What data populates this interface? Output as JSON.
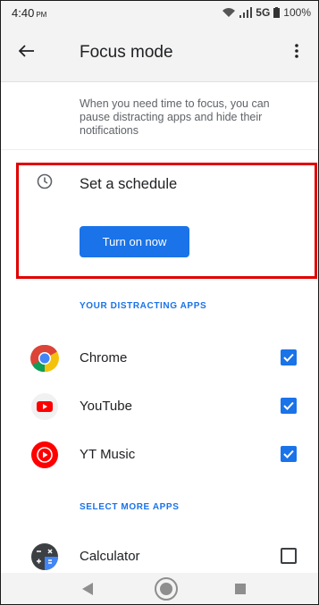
{
  "status_bar": {
    "time": "4:40",
    "ampm": "PM",
    "network": "5G",
    "battery": "100%"
  },
  "app_bar": {
    "title": "Focus mode"
  },
  "description": "When you need time to focus, you can pause distracting apps and hide their notifications",
  "schedule": {
    "label": "Set a schedule",
    "button_label": "Turn on now"
  },
  "distracting_apps": {
    "header": "YOUR DISTRACTING APPS",
    "apps": [
      {
        "name": "Chrome",
        "checked": true,
        "icon": "chrome-icon"
      },
      {
        "name": "YouTube",
        "checked": true,
        "icon": "youtube-icon"
      },
      {
        "name": "YT Music",
        "checked": true,
        "icon": "yt-music-icon"
      }
    ]
  },
  "more_apps": {
    "header": "SELECT MORE APPS",
    "apps": [
      {
        "name": "Calculator",
        "checked": false,
        "icon": "calculator-icon"
      }
    ]
  },
  "colors": {
    "accent": "#1a73e8",
    "highlight": "#e00000"
  }
}
